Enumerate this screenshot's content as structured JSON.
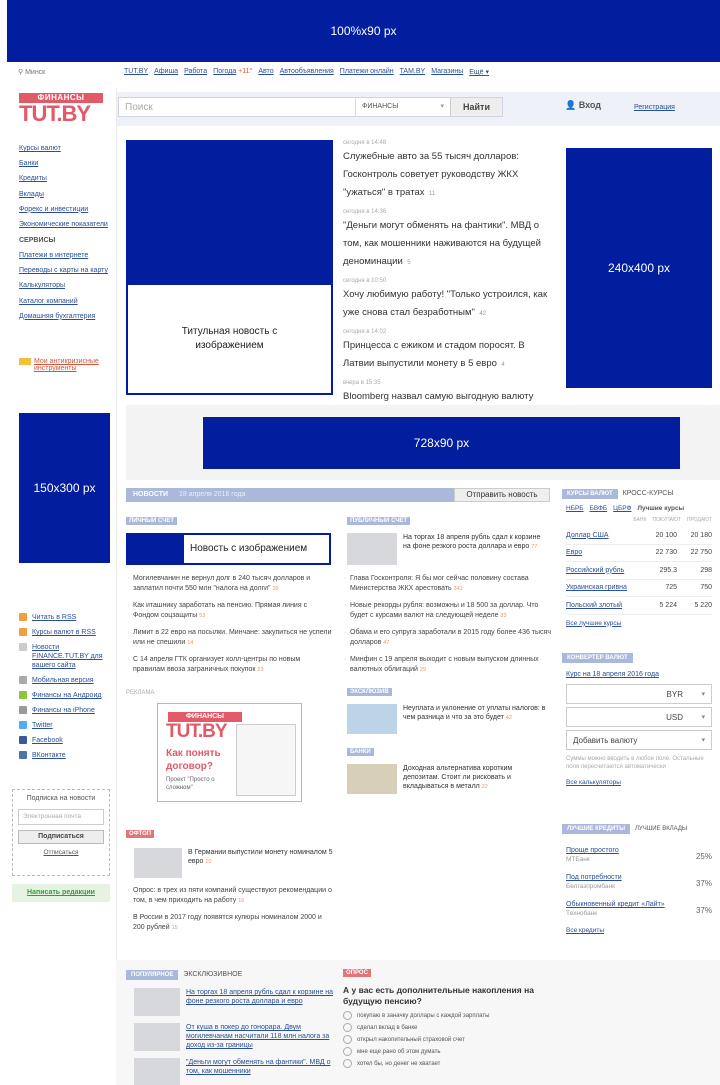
{
  "banners": {
    "top": "100%x90 px",
    "right": "240x400 px",
    "middle": "728x90 px",
    "left": "150x300 px"
  },
  "topnav": {
    "city": "Минск",
    "links": [
      "TUT.BY",
      "Афиша",
      "Работа",
      "Погода",
      "Авто",
      "Автообъявления",
      "Платежи онлайн",
      "TAM.BY",
      "Магазины",
      "Ещё"
    ],
    "temp": "+11°"
  },
  "header": {
    "logo_top": "ФИНАНСЫ",
    "logo_main": "TUT.BY",
    "search_placeholder": "Поиск",
    "search_section": "ФИНАНСЫ",
    "search_button": "Найти",
    "login": "Вход",
    "register": "Регистрация"
  },
  "leftnav": {
    "items": [
      "Курсы валют",
      "Банки",
      "Кредиты",
      "Вклады",
      "Форекс и инвестиции",
      "Экономические показатели"
    ],
    "services_heading": "СЕРВИСЫ",
    "services": [
      "Платежи в интернете",
      "Переводы с карты на карту",
      "Калькуляторы",
      "Каталог компаний",
      "Домашняя бухгалтерия"
    ],
    "promo": "Мои антикризисные инструменты"
  },
  "main_news": {
    "image_caption": "Титульная новость с изображением",
    "items": [
      {
        "time": "сегодня в 14:48",
        "title": "Служебные авто за 55 тысяч долларов: Госконтроль советует руководству ЖКХ \"ужаться\" в тратах",
        "comments": "11"
      },
      {
        "time": "сегодня в 14:36",
        "title": "\"Деньги могут обменять на фантики\". МВД о том, как мошенники наживаются на будущей деноминации",
        "comments": "5"
      },
      {
        "time": "сегодня в 10:50",
        "title": "Хочу любимую работу! \"Только устроился, как уже снова стал безработным\"",
        "comments": "42"
      },
      {
        "time": "сегодня в 14:02",
        "title": "Принцесса с ежиком и стадом поросят. В Латвии выпустили монету в 5 евро",
        "comments": "4"
      },
      {
        "time": "вчера в 15:35",
        "title": "Bloomberg назвал самую выгодную валюту 2016 года",
        "comments": "41"
      }
    ]
  },
  "side_links": [
    {
      "icon": "rss-icon",
      "label": "Читать в RSS"
    },
    {
      "icon": "rss-icon",
      "label": "Курсы валют в RSS"
    },
    {
      "icon": "news-icon",
      "label": "Новости FINANCE.TUT.BY для вашего сайта"
    },
    {
      "icon": "mobile-icon",
      "label": "Мобильная версия"
    },
    {
      "icon": "android-icon",
      "label": "Финансы на Андроид"
    },
    {
      "icon": "apple-icon",
      "label": "Финансы на iPhone"
    },
    {
      "icon": "twitter-icon",
      "label": "Twitter"
    },
    {
      "icon": "facebook-icon",
      "label": "Facebook"
    },
    {
      "icon": "vk-icon",
      "label": "ВКонтакте"
    }
  ],
  "subscribe": {
    "title": "Подписка на новости",
    "placeholder": "Электронная почта",
    "button": "Подписаться",
    "unsubscribe": "Отписаться"
  },
  "write_editors": "Написать редакции",
  "news_bar": {
    "label": "НОВОСТИ",
    "date": "18 апреля 2016 года",
    "button": "Отправить новость"
  },
  "personal": {
    "tag": "ЛИЧНЫЙ СЧЕТ",
    "image_caption": "Новость с изображением",
    "items": [
      {
        "text": "Могилевчанин не вернул долг в 240 тысяч долларов и заплатил почти 550 млн \"налога на долги\"",
        "n": "39"
      },
      {
        "text": "Как иташнику заработать на пенсию. Прямая линия с Фондом соцзащиты",
        "n": "53"
      },
      {
        "text": "Лимит в 22 евро на посылки. Минчане: закупиться не успели или не спешили",
        "n": "14"
      },
      {
        "text": "С 14 апреля ГТК организует колл-центры по новым правилам ввоза заграничных покупок",
        "n": "23"
      }
    ]
  },
  "ad": {
    "label": "РЕКЛАМА",
    "fin": "ФИНАНСЫ",
    "tut": "TUT.BY",
    "question": "Как понять договор?",
    "project": "Проект \"Просто о сложном\""
  },
  "public": {
    "tag": "ПУБЛИЧНЫЙ СЧЕТ",
    "lead": {
      "text": "На торгах 18 апреля рубль сдал к корзине на фоне резкого роста доллара и евро",
      "n": "77"
    },
    "items": [
      {
        "text": "Глава Госконтроля: Я бы мог сейчас половину состава Министерства ЖКХ арестовать",
        "n": "341"
      },
      {
        "text": "Новые рекорды рубля: возможны и 18 500 за доллар. Что будет с курсами валют на следующей неделе",
        "n": "83"
      },
      {
        "text": "Обама и его супруга заработали в 2015 году более 436 тысяч долларов",
        "n": "47"
      },
      {
        "text": "Минфин с 19 апреля выходит с новым выпуском длинных валютных облигаций",
        "n": "29"
      }
    ]
  },
  "exclusive": {
    "tag": "ЭКСКЛЮЗИВ",
    "text": "Неуплата и уклонение от уплаты налогов: в чем разница и что за это будет",
    "n": "42"
  },
  "banks": {
    "tag": "БАНКИ",
    "text": "Доходная альтернатива коротким депозитам. Стоит ли рисковать и вкладываться в металл",
    "n": "22"
  },
  "offtop": {
    "tag": "ОФТОП",
    "lead": {
      "text": "В Германии выпустили монету номиналом 5 евро",
      "n": "10"
    },
    "items": [
      {
        "text": "Опрос: в трех из пяти компаний существуют рекомендации о том, в чем приходить на работу",
        "n": "16"
      },
      {
        "text": "В России в 2017 году появятся купюры номиналом 2000 и 200 рублей",
        "n": "15"
      }
    ]
  },
  "rates": {
    "tab_active": "КУРСЫ ВАЛЮТ",
    "tab_other": "КРОСС-КУРСЫ",
    "sources": [
      "НБРБ",
      "БВФБ",
      "ЦБРФ"
    ],
    "best": "Лучшие курсы",
    "cols": [
      "БАНК",
      "ПОКУПАЮТ",
      "ПРОДАЮТ"
    ],
    "rows": [
      {
        "name": "Доллар США",
        "buy": "20 100",
        "sell": "20 180"
      },
      {
        "name": "Евро",
        "buy": "22 730",
        "sell": "22 750"
      },
      {
        "name": "Российский рубль",
        "buy": "295.3",
        "sell": "298"
      },
      {
        "name": "Украинская гривна",
        "buy": "725",
        "sell": "750"
      },
      {
        "name": "Польский злотый",
        "buy": "5 224",
        "sell": "5 220"
      }
    ],
    "all_link": "Все лучшие курсы"
  },
  "converter": {
    "tab": "КОНВЕРТЕР ВАЛЮТ",
    "date_link": "Курс на 18 апреля 2016 года",
    "cur1": "BYR",
    "cur2": "USD",
    "add": "Добавить валюту",
    "note": "Суммы можно вводить в любое поле. Остальные поля пересчитаются автоматически",
    "all_link": "Все калькуляторы"
  },
  "credits": {
    "tab_active": "ЛУЧШИЕ КРЕДИТЫ",
    "tab_other": "ЛУЧШИЕ ВКЛАДЫ",
    "items": [
      {
        "name": "Проще простого",
        "bank": "МТБанк",
        "pct": "25%"
      },
      {
        "name": "Под потребности",
        "bank": "Белгазпромбанк",
        "pct": "37%"
      },
      {
        "name": "Обыкновенный кредит «Лайт»",
        "bank": "Технобанк",
        "pct": "37%"
      }
    ],
    "all_link": "Все кредиты"
  },
  "popular": {
    "tab_active": "ПОПУЛЯРНОЕ",
    "tab_other": "ЭКСКЛЮЗИВНОЕ",
    "items": [
      "На торгах 18 апреля рубль сдал к корзине на фоне резкого роста доллара и евро",
      "От куша в покер до гонорара. Двум могилевчанам насчитали 118 млн налога за доход из-за границы",
      "\"Деньги могут обменять на фантики\". МВД о том, как мошенники"
    ]
  },
  "poll": {
    "tag": "ОПРОС",
    "question": "А у вас есть дополнительные накопления на будущую пенсию?",
    "options": [
      "покупаю в заначку доллары с каждой зарплаты",
      "сделал вклад в банке",
      "открыл накопительный страховой счет",
      "мне еще рано об этом думать",
      "хотел бы, но денег не хватает"
    ]
  }
}
